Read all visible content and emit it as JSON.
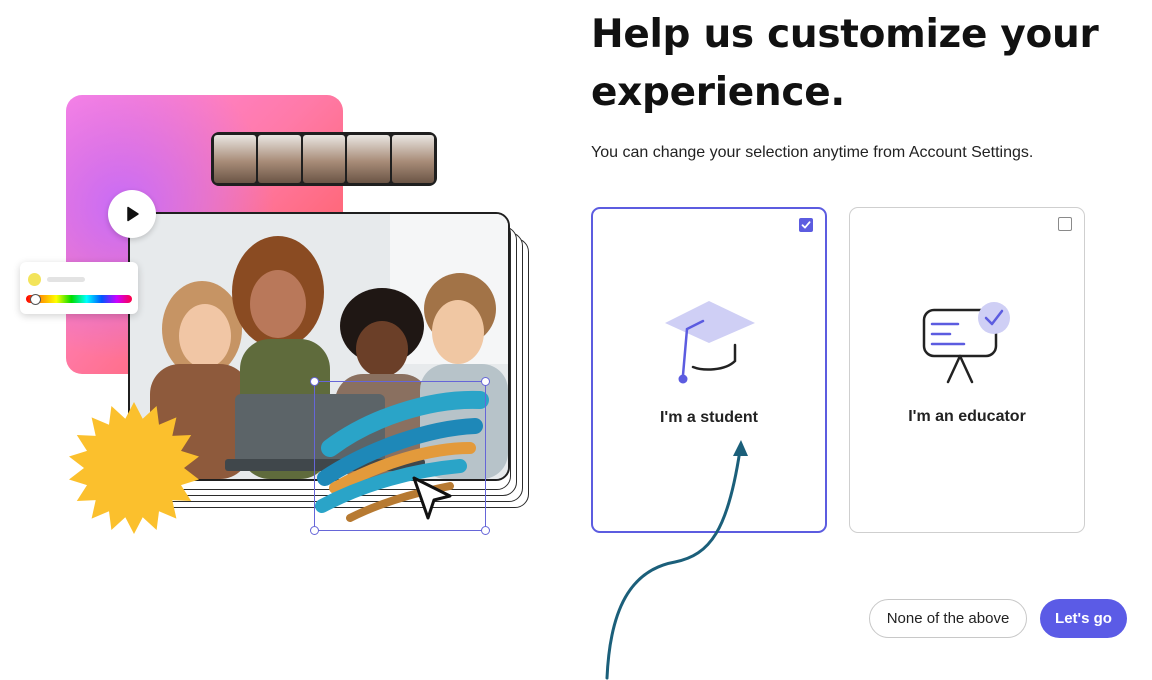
{
  "heading": "Help us customize your experience.",
  "subtitle": "You can change your selection anytime from Account Settings.",
  "options": [
    {
      "label": "I'm a student",
      "selected": true,
      "icon": "graduation-cap-icon"
    },
    {
      "label": "I'm an educator",
      "selected": false,
      "icon": "presentation-board-icon"
    }
  ],
  "buttons": {
    "none_label": "None of the above",
    "go_label": "Let's go"
  },
  "colors": {
    "accent": "#5c5ce0",
    "annotation_arrow": "#1b5f7a",
    "sunburst": "#fbc02d"
  }
}
